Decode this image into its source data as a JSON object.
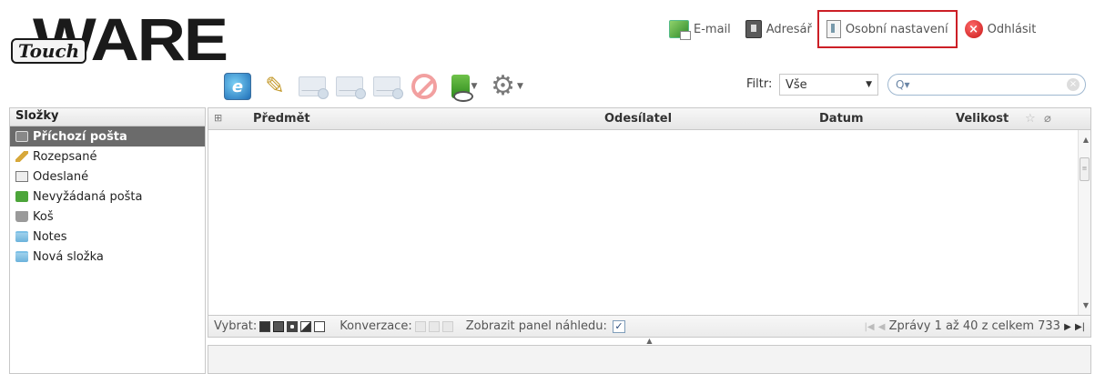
{
  "logo": {
    "brand": "WARE",
    "sub": "Touch"
  },
  "toplinks": {
    "email": "E-mail",
    "addressbook": "Adresář",
    "settings": "Osobní nastavení",
    "logout": "Odhlásit"
  },
  "filter": {
    "label": "Filtr:",
    "value": "Vše"
  },
  "search": {
    "placeholder": ""
  },
  "folders": {
    "header": "Složky",
    "items": [
      "Příchozí pošta",
      "Rozepsané",
      "Odeslané",
      "Nevyžádaná pošta",
      "Koš",
      "Notes",
      "Nová složka"
    ]
  },
  "columns": {
    "subject": "Předmět",
    "sender": "Odesílatel",
    "date": "Datum",
    "size": "Velikost"
  },
  "footer": {
    "select_label": "Vybrat:",
    "conversation_label": "Konverzace:",
    "preview_label": "Zobrazit panel náhledu:",
    "preview_checked": "✓",
    "pager_text": "Zprávy 1 až 40 z celkem 733"
  },
  "colors": {
    "highlight": "#cc1f26",
    "active_folder": "#6b6b6b"
  }
}
